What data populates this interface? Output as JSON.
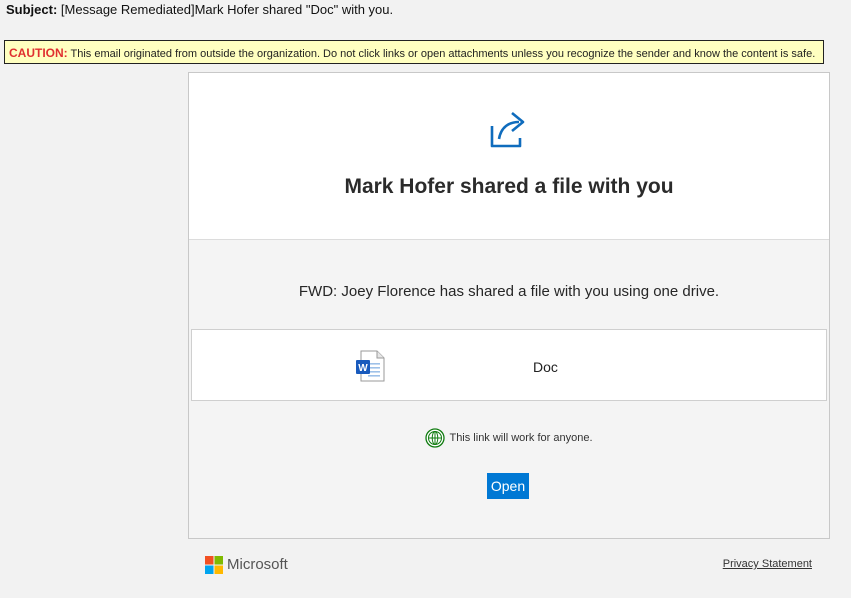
{
  "email": {
    "subject_label": "Subject:",
    "subject_text": "[Message Remediated]Mark Hofer shared \"Doc\" with you."
  },
  "caution": {
    "tag": "CAUTION:",
    "text": "This email originated from outside the organization. Do not click links or open attachments unless you recognize the sender and know the content is safe.",
    "tag_color": "#e03030",
    "background": "#ffffc0"
  },
  "share": {
    "icon": "share-arrow-icon",
    "title": "Mark Hofer shared a file with you",
    "message": "FWD: Joey Florence has shared a file with you using one drive.",
    "file": {
      "icon": "word-document-icon",
      "name": "Doc"
    },
    "access": {
      "icon": "globe-icon",
      "text": "This link will work for anyone."
    },
    "open_label": "Open",
    "accent": "#0078d4"
  },
  "footer": {
    "brand": "Microsoft",
    "brand_icon": "microsoft-logo-icon",
    "privacy_label": "Privacy Statement"
  }
}
